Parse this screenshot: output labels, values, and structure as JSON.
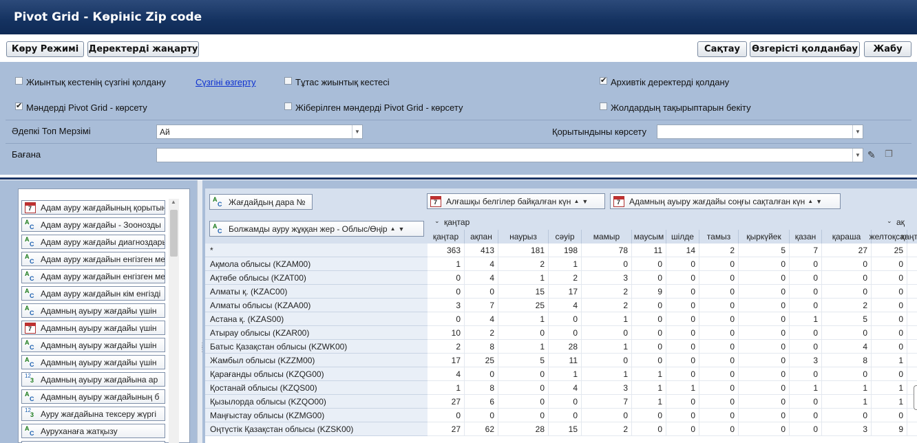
{
  "window": {
    "title": "Pivot Grid - Көрініс Zip code"
  },
  "toolbar": {
    "view_mode": "Көру Режимі",
    "refresh": "Деректерді жаңарту",
    "save": "Сақтау",
    "cancel_changes": "Өзгерісті қолданбау",
    "close": "Жабу"
  },
  "options": {
    "use_pivot_filter": {
      "label": "Жиынтық кестенің сүзгіні қолдану",
      "checked": false
    },
    "edit_filter_link": "Сүзгіні өзгерту",
    "full_pivot": {
      "label": "Тұтас жиынтық кестесі",
      "checked": false
    },
    "use_archive": {
      "label": "Архивтік деректерді қолдану",
      "checked": true
    },
    "show_values": {
      "label": "Мәндерді Pivot Grid - көрсету",
      "checked": true
    },
    "show_missing": {
      "label": "Жіберілген мәндерді Pivot Grid - көрсету",
      "checked": false
    },
    "freeze_row_headers": {
      "label": "Жолдардың тақырыптарын бекіту",
      "checked": false
    },
    "default_group_period": {
      "label": "Әдепкі Топ Мерзімі",
      "value": "Ай"
    },
    "show_totals": {
      "label": "Қорытындыны көрсету",
      "value": ""
    },
    "column": {
      "label": "Бағана",
      "value": ""
    }
  },
  "field_list": [
    {
      "icon": "cal",
      "label": "Адам ауру жағдайының қорытынды"
    },
    {
      "icon": "abc",
      "label": "Адам ауру жағдайы - Зоонозды"
    },
    {
      "icon": "abc",
      "label": "Адам ауру жағдайы диагноздары"
    },
    {
      "icon": "abc",
      "label": "Адам ауру жағдайын енгізген ме"
    },
    {
      "icon": "abc",
      "label": "Адам ауру жағдайын енгізген ме"
    },
    {
      "icon": "abc",
      "label": "Адам ауру жағдайын кім енгізді"
    },
    {
      "icon": "abc",
      "label": "Адамның ауыру жағдайы үшін"
    },
    {
      "icon": "cal",
      "label": "Адамның ауыру жағдайы үшін"
    },
    {
      "icon": "abc",
      "label": "Адамның ауыру жағдайы үшін"
    },
    {
      "icon": "abc",
      "label": "Адамның ауыру жағдайы үшін"
    },
    {
      "icon": "num",
      "label": "Адамның ауыру жағдайына ар"
    },
    {
      "icon": "abc",
      "label": "Адамның ауыру жағдайының б"
    },
    {
      "icon": "num",
      "label": "Ауру жағдайына тексеру жүргі"
    },
    {
      "icon": "abc",
      "label": "Ауруханаға жатқызу"
    },
    {
      "icon": "abc",
      "label": ""
    }
  ],
  "pivot": {
    "filter_field": "Жағдайдың дара №",
    "col_field_1": "Алғашқы белгілер байқалған күн",
    "col_field_2": "Адамның ауыру жағдайы соңғы сақталған күн",
    "row_field": "Болжамды ауру жұққан жер - Облыс/Өңір",
    "year_group_1": "қаңтар",
    "year_group_2": "ақ",
    "months": [
      "қаңтар",
      "ақпан",
      "наурыз",
      "сәуір",
      "мамыр",
      "маусым",
      "шілде",
      "тамыз",
      "қыркүйек",
      "қазан",
      "қараша",
      "желтоқсан",
      "қаңтар"
    ],
    "rows": [
      {
        "label": "*",
        "values": [
          "363",
          "413",
          "181",
          "198",
          "78",
          "11",
          "14",
          "2",
          "5",
          "7",
          "27",
          "25",
          ""
        ]
      },
      {
        "label": "Ақмола облысы (KZAM00)",
        "values": [
          "1",
          "4",
          "2",
          "1",
          "0",
          "0",
          "0",
          "0",
          "0",
          "0",
          "0",
          "0",
          ""
        ]
      },
      {
        "label": "Ақтөбе облысы (KZAT00)",
        "values": [
          "0",
          "4",
          "1",
          "2",
          "3",
          "0",
          "0",
          "0",
          "0",
          "0",
          "0",
          "0",
          ""
        ]
      },
      {
        "label": "Алматы қ. (KZAC00)",
        "values": [
          "0",
          "0",
          "15",
          "17",
          "2",
          "9",
          "0",
          "0",
          "0",
          "0",
          "0",
          "0",
          ""
        ]
      },
      {
        "label": "Алматы облысы (KZAA00)",
        "values": [
          "3",
          "7",
          "25",
          "4",
          "2",
          "0",
          "0",
          "0",
          "0",
          "0",
          "2",
          "0",
          ""
        ]
      },
      {
        "label": "Астана қ. (KZAS00)",
        "values": [
          "0",
          "4",
          "1",
          "0",
          "1",
          "0",
          "0",
          "0",
          "0",
          "1",
          "5",
          "0",
          ""
        ]
      },
      {
        "label": "Атырау облысы (KZAR00)",
        "values": [
          "10",
          "2",
          "0",
          "0",
          "0",
          "0",
          "0",
          "0",
          "0",
          "0",
          "0",
          "0",
          ""
        ]
      },
      {
        "label": "Батыс Қазақстан облысы (KZWK00)",
        "values": [
          "2",
          "8",
          "1",
          "28",
          "1",
          "0",
          "0",
          "0",
          "0",
          "0",
          "4",
          "0",
          ""
        ]
      },
      {
        "label": "Жамбыл облысы (KZZM00)",
        "values": [
          "17",
          "25",
          "5",
          "11",
          "0",
          "0",
          "0",
          "0",
          "0",
          "3",
          "8",
          "1",
          ""
        ]
      },
      {
        "label": "Қарағанды облысы (KZQG00)",
        "values": [
          "4",
          "0",
          "0",
          "1",
          "1",
          "1",
          "0",
          "0",
          "0",
          "0",
          "0",
          "0",
          ""
        ]
      },
      {
        "label": "Қостанай облысы (KZQS00)",
        "values": [
          "1",
          "8",
          "0",
          "4",
          "3",
          "1",
          "1",
          "0",
          "0",
          "1",
          "1",
          "1",
          ""
        ]
      },
      {
        "label": "Қызылорда облысы (KZQO00)",
        "values": [
          "27",
          "6",
          "0",
          "0",
          "7",
          "1",
          "0",
          "0",
          "0",
          "0",
          "1",
          "1",
          ""
        ]
      },
      {
        "label": "Маңғыстау облысы (KZMG00)",
        "values": [
          "0",
          "0",
          "0",
          "0",
          "0",
          "0",
          "0",
          "0",
          "0",
          "0",
          "0",
          "0",
          ""
        ]
      },
      {
        "label": "Оңтүстік Қазақстан облысы (KZSK00)",
        "values": [
          "27",
          "62",
          "28",
          "15",
          "2",
          "0",
          "0",
          "0",
          "0",
          "0",
          "3",
          "9",
          ""
        ]
      }
    ]
  }
}
